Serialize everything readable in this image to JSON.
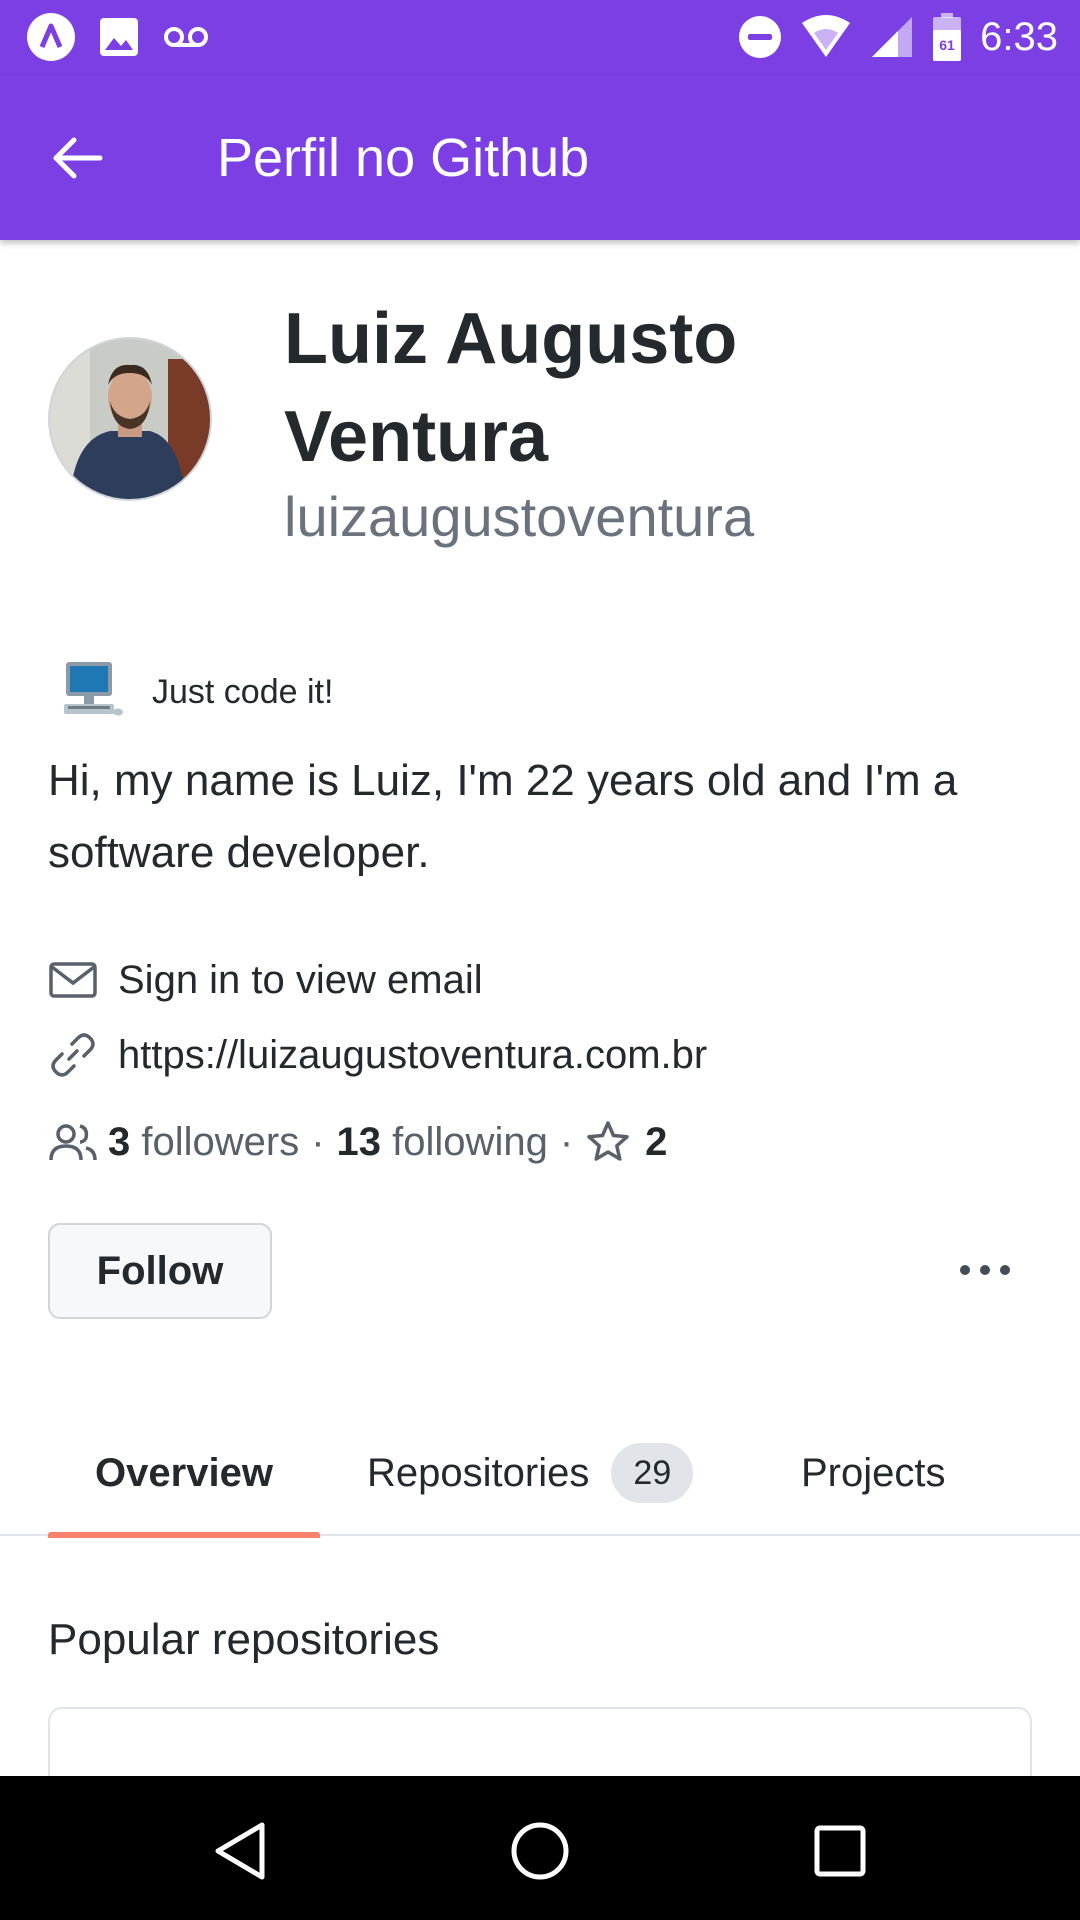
{
  "status_bar": {
    "time": "6:33",
    "icons": [
      "app-notification-icon",
      "image-notification-icon",
      "voicemail-icon",
      "do-not-disturb-icon",
      "wifi-icon",
      "cell-signal-icon",
      "battery-icon"
    ],
    "battery_level": "61"
  },
  "app_bar": {
    "title": "Perfil no Github",
    "back_icon": "arrow-back-icon"
  },
  "profile": {
    "full_name": "Luiz Augusto Ventura",
    "username": "luizaugustoventura",
    "status_emoji": "desktop-computer-emoji",
    "status_message": "Just code it!",
    "bio": "Hi, my name is Luiz, I'm 22 years old and I'm a software developer.",
    "email_text": "Sign in to view email",
    "website": "https://luizaugustoventura.com.br",
    "followers_count": "3",
    "followers_label": "followers",
    "following_count": "13",
    "following_label": "following",
    "stars_count": "2",
    "separator": "·",
    "follow_label": "Follow"
  },
  "tabs": [
    {
      "label": "Overview",
      "active": true
    },
    {
      "label": "Repositories",
      "count": "29"
    },
    {
      "label": "Projects"
    }
  ],
  "popular": {
    "title": "Popular repositories"
  },
  "colors": {
    "app_bar": "#7b3fe4",
    "tab_underline": "#f9826c",
    "link": "#0366d6",
    "text": "#24292e",
    "muted": "#586069"
  }
}
